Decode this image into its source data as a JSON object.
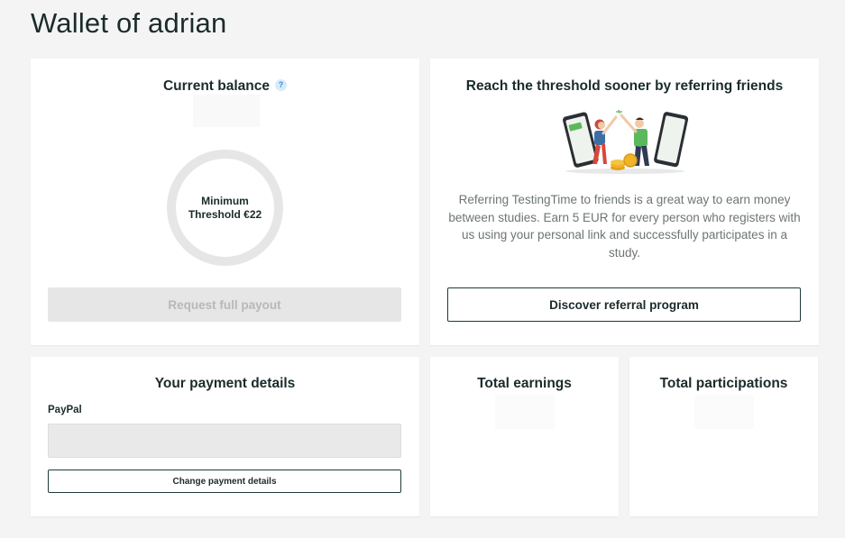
{
  "page": {
    "title": "Wallet of adrian"
  },
  "balance": {
    "title": "Current balance",
    "help_glyph": "?",
    "ring_label": "Minimum Threshold €22",
    "payout_button": "Request full payout"
  },
  "referral": {
    "title": "Reach the threshold sooner by referring friends",
    "description": "Referring TestingTime to friends is a great way to earn money between studies. Earn 5 EUR for every person who registers with us using your personal link and successfully participates in a study.",
    "button": "Discover referral program"
  },
  "payment": {
    "title": "Your payment details",
    "method_label": "PayPal",
    "input_value": "",
    "change_button": "Change payment details"
  },
  "earnings": {
    "title": "Total earnings"
  },
  "participations": {
    "title": "Total participations"
  },
  "colors": {
    "background": "#f4f4f4",
    "card": "#ffffff",
    "text": "#1b2b2b",
    "muted_text": "#6e7474",
    "disabled_button": "#e6e6e6",
    "help_icon": "#3d8fd6",
    "accent_green": "#5cb85c",
    "coin": "#f0b428"
  },
  "icons": {
    "help": "question-icon",
    "illustration": "high-five-phones-illustration"
  }
}
